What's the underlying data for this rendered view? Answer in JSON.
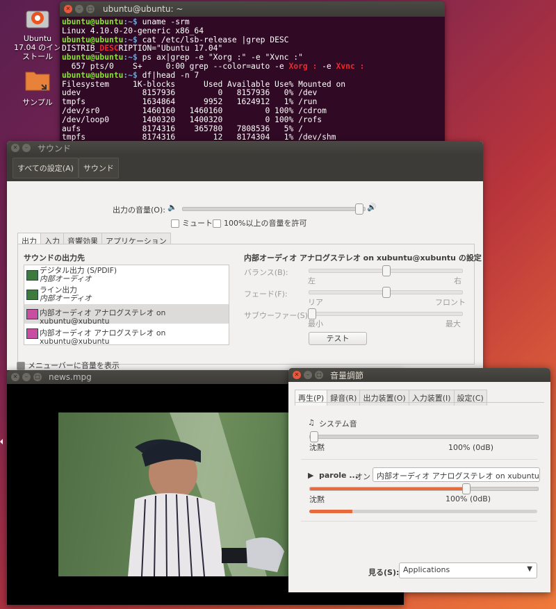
{
  "desktop": {
    "icons": [
      {
        "label_line1": "Ubuntu",
        "label_line2": "17.04 のイン",
        "label_line3": "ストール"
      },
      {
        "label_line1": "サンプル"
      }
    ]
  },
  "terminal": {
    "title": "ubuntu@ubuntu: ~",
    "lines": {
      "p1": "ubuntu@ubuntu",
      "path": ":~$",
      "c1": " uname -srm",
      "o1": "Linux 4.10.0-20-generic x86_64",
      "c2": " cat /etc/lsb-release |grep DESC",
      "o2a": "DISTRIB_",
      "o2b": "DESC",
      "o2c": "RIPTION=\"Ubuntu 17.04\"",
      "c3": " ps ax|grep -e \"Xorg :\" -e \"Xvnc :\"",
      "o3a": "  657 pts/0    S+     0:00 grep --color=auto -e ",
      "o3b": "Xorg :",
      "o3c": " -e ",
      "o3d": "Xvnc :",
      "c4": " df|head -n 7",
      "h": "Filesystem     1K-blocks      Used Available Use% Mounted on",
      "r1": "udev             8157936         0   8157936   0% /dev",
      "r2": "tmpfs            1634864      9952   1624912   1% /run",
      "r3": "/dev/sr0         1460160   1460160         0 100% /cdrom",
      "r4": "/dev/loop0       1400320   1400320         0 100% /rofs",
      "r5": "aufs             8174316    365780   7808536   5% /",
      "r6": "tmpfs            8174316        12   8174304   1% /dev/shm"
    }
  },
  "sound": {
    "title": "サウンド",
    "toolbar": {
      "all_settings": "すべての設定(A)",
      "sound": "サウンド"
    },
    "output_volume_label": "出力の音量(O):",
    "output_volume_level": 0.985,
    "mute_label": "ミュート",
    "allow_over_label": "100%以上の音量を許可",
    "tabs": [
      "出力",
      "入力",
      "音響効果",
      "アプリケーション"
    ],
    "device_header": "サウンドの出力先",
    "devices": [
      {
        "name": "デジタル出力 (S/PDIF)",
        "sub": "内部オーディオ"
      },
      {
        "name": "ライン出力",
        "sub": "内部オーディオ"
      },
      {
        "name": "内部オーディオ アナログステレオ on xubuntu@xubuntu",
        "sub": ""
      },
      {
        "name": "内部オーディオ アナログステレオ on xubuntu@xubuntu",
        "sub": ""
      }
    ],
    "settings_header": "内部オーディオ アナログステレオ on xubuntu@xubuntu の設定",
    "balance_label": "バランス(B):",
    "balance_left": "左",
    "balance_right": "右",
    "fade_label": "フェード(F):",
    "fade_rear": "リア",
    "fade_front": "フロント",
    "sub_label": "サブウーファー(S):",
    "sub_min": "最小",
    "sub_max": "最大",
    "test_button": "テスト",
    "menubar_label": "メニューバーに音量を表示"
  },
  "video": {
    "title": "news.mpg"
  },
  "volume": {
    "title": "音量調節",
    "tabs": [
      "再生(P)",
      "録音(R)",
      "出力装置(O)",
      "入力装置(I)",
      "設定(C)"
    ],
    "system_sound": "システム音",
    "mute_text": "沈黙",
    "hundred": "100% (0dB)",
    "system_level": 0,
    "app_name": "parole ...",
    "app_state": "オン",
    "app_device": "内部オーディオ アナログステレオ on xubuntu@x",
    "app_level": 0.69,
    "app_meter": 0.19,
    "view_label": "見る(S):",
    "view_value": "Applications"
  },
  "colors": {
    "terminal_bg": "#300a24",
    "accent": "#e66a3b",
    "close": "#e9573c"
  }
}
